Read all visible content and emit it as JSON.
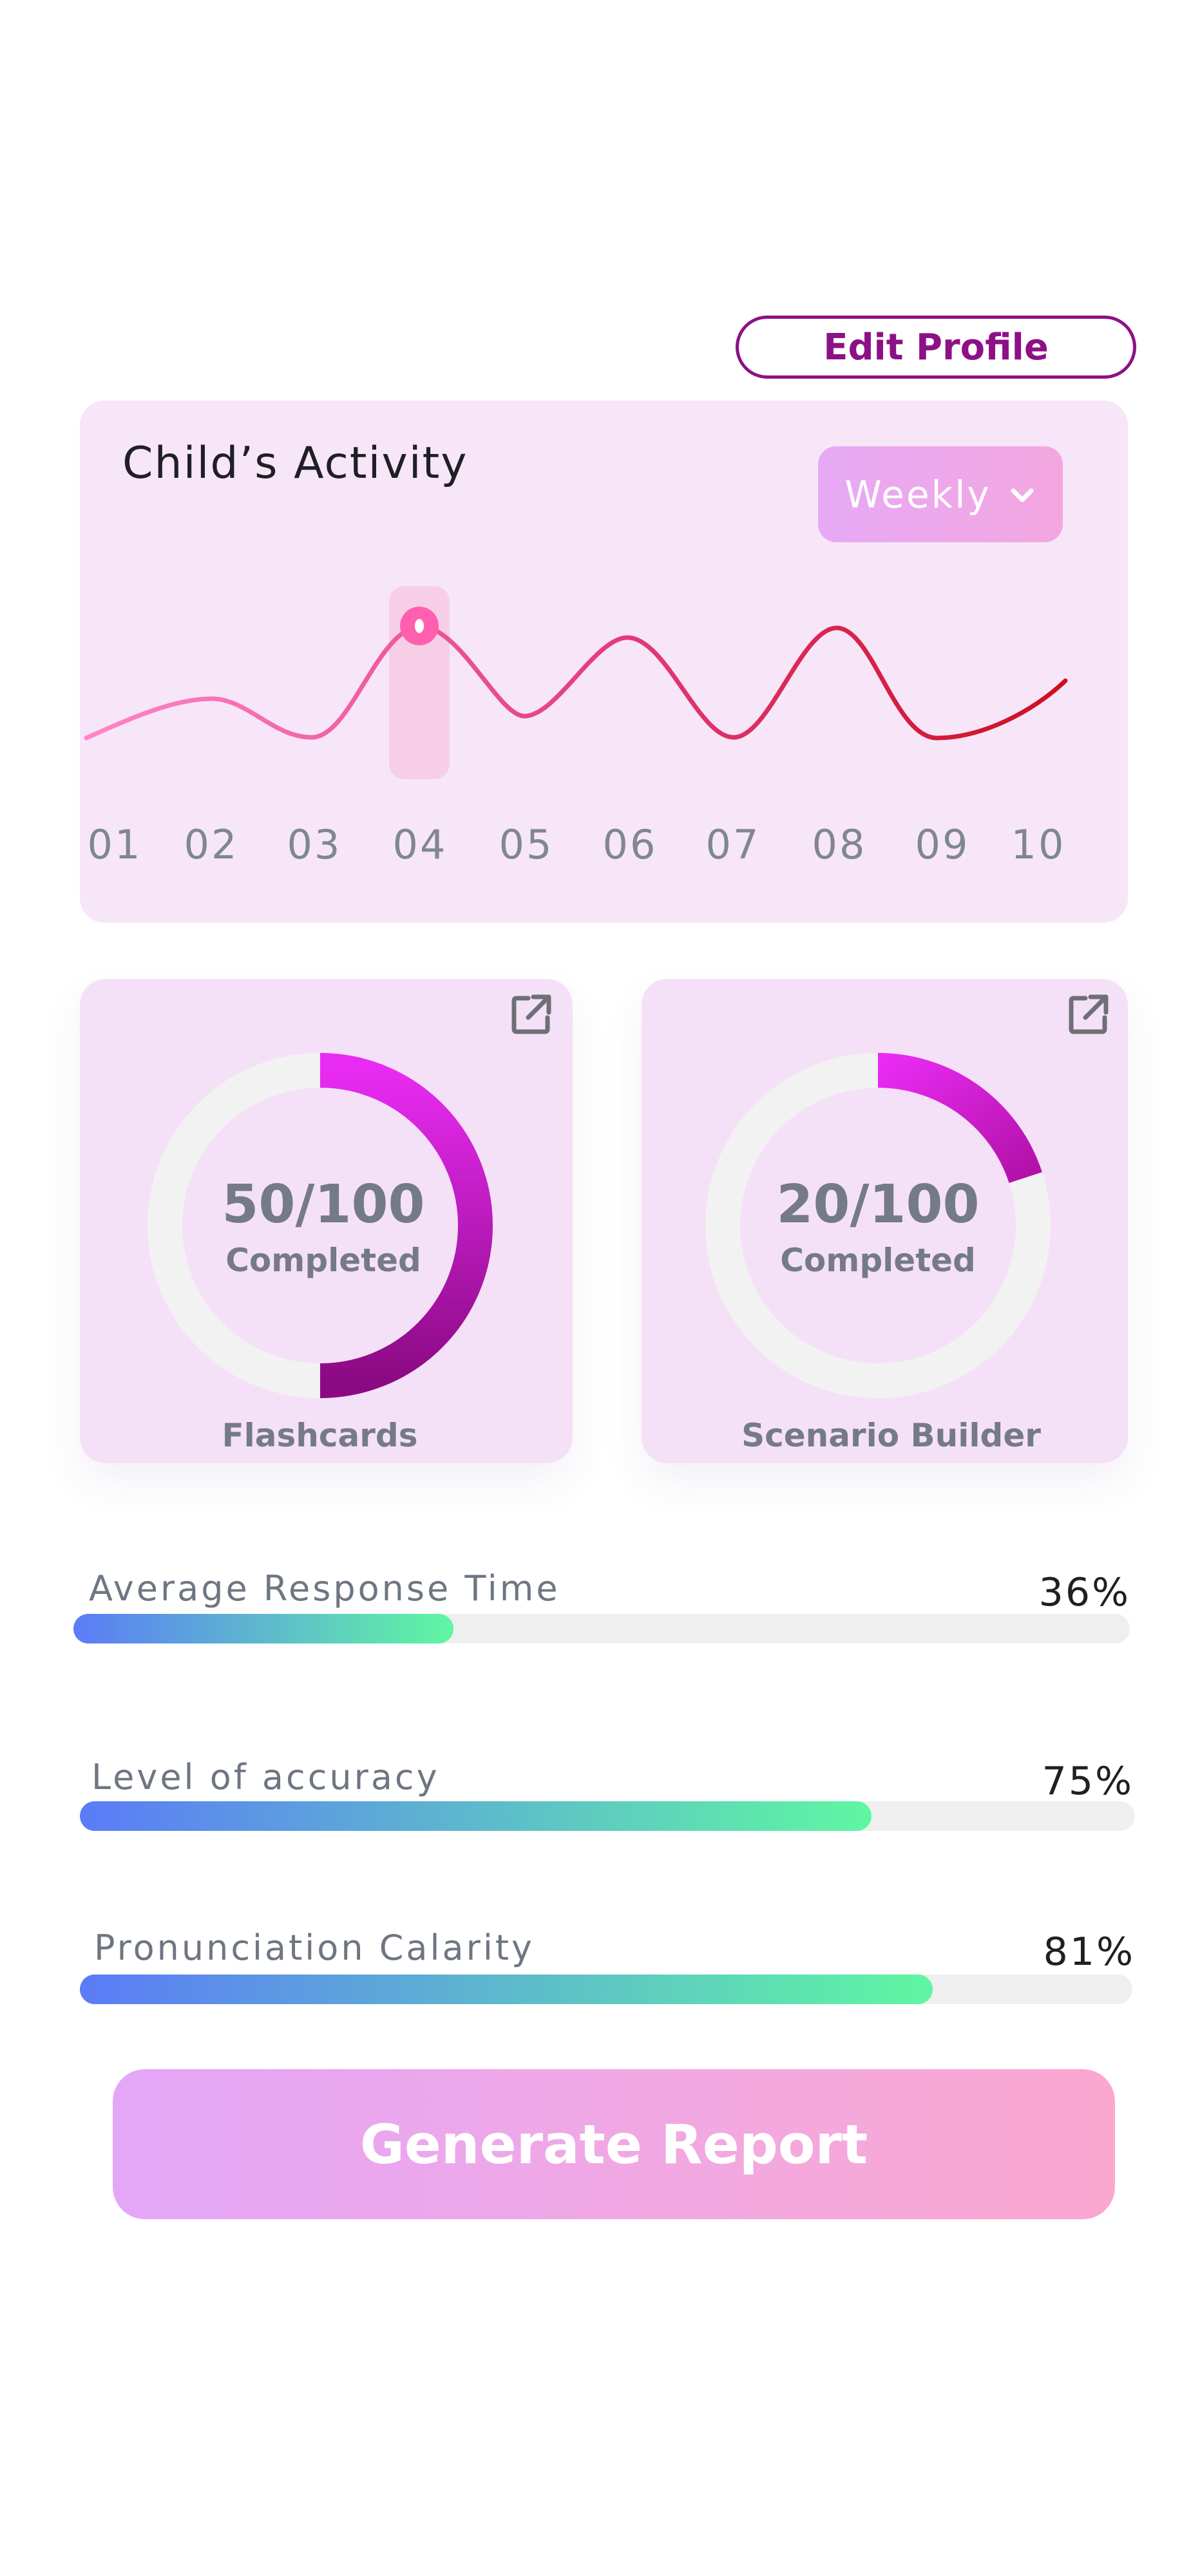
{
  "header": {
    "edit_profile_label": "Edit Profile"
  },
  "activity": {
    "title": "Child’s Activity",
    "period_label": "Weekly",
    "x_labels": [
      "01",
      "02",
      "03",
      "04",
      "05",
      "06",
      "07",
      "08",
      "09",
      "10"
    ],
    "highlighted_label": "04",
    "colors": {
      "line_start": "#ff85c8",
      "line_end": "#cc0f1f",
      "highlight": "#f6cfe6",
      "marker": "#ff5fae"
    }
  },
  "cards": {
    "flashcards": {
      "value_text": "50/100",
      "status": "Completed",
      "label": "Flashcards",
      "progress": 0.5
    },
    "scenario": {
      "value_text": "20/100",
      "status": "Completed",
      "label": "Scenario Builder",
      "progress": 0.2
    }
  },
  "metrics": [
    {
      "label": "Average Response Time",
      "value_text": "36%",
      "progress": 0.36
    },
    {
      "label": "Level of accuracy",
      "value_text": "75%",
      "progress": 0.75
    },
    {
      "label": "Pronunciation Calarity",
      "value_text": "81%",
      "progress": 0.81
    }
  ],
  "actions": {
    "generate_report_label": "Generate Report"
  },
  "colors": {
    "accent": "#8d1186",
    "card_bg": "#f7e6f8",
    "ring_start": "#e82bf2",
    "ring_end": "#8b0a83",
    "bar_start": "#5b7bf7",
    "bar_end": "#5ff7a2"
  }
}
